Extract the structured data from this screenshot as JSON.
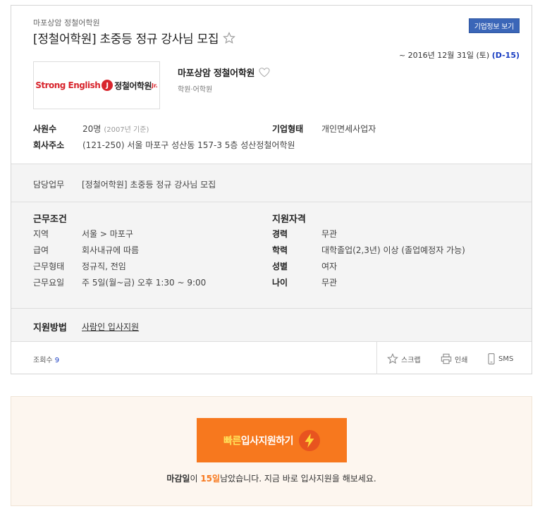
{
  "header": {
    "company_small": "마포상암 정철어학원",
    "title": "[정철어학원] 초중등 정규 강사님 모집",
    "company_info_button": "기업정보 보기",
    "deadline_text": "~ 2016년 12월 31일 (토)",
    "dday": "(D-15)"
  },
  "company": {
    "logo": {
      "brand_en": "Strong English",
      "brand_mark": "J",
      "brand_kr": "정철어학원",
      "brand_jr": "Jr."
    },
    "name": "마포상암 정철어학원",
    "category": "학원·어학원",
    "employees_label": "사원수",
    "employees_value": "20명",
    "employees_note": "(2007년 기준)",
    "type_label": "기업형태",
    "type_value": "개인면세사업자",
    "address_label": "회사주소",
    "address_value": "(121-250) 서울 마포구 성산동 157-3 5층 성산정철어학원"
  },
  "duty": {
    "label": "담당업무",
    "value": "[정철어학원] 초중등 정규 강사님 모집"
  },
  "conditions": {
    "title": "근무조건",
    "items": [
      {
        "label": "지역",
        "value": "서울 > 마포구"
      },
      {
        "label": "급여",
        "value": "회사내규에 따름"
      },
      {
        "label": "근무형태",
        "value": "정규직, 전임"
      },
      {
        "label": "근무요일",
        "value": "주 5일(월~금) 오후 1:30 ~ 9:00"
      }
    ]
  },
  "qualifications": {
    "title": "지원자격",
    "items": [
      {
        "label": "경력",
        "value": "무관"
      },
      {
        "label": "학력",
        "value": "대학졸업(2,3년) 이상 (졸업예정자 가능)"
      },
      {
        "label": "성별",
        "value": "여자"
      },
      {
        "label": "나이",
        "value": "무관"
      }
    ]
  },
  "apply_method": {
    "label": "지원방법",
    "link": "사람인 입사지원"
  },
  "footer": {
    "views_label": "조회수",
    "views_count": "9",
    "scrap": "스크랩",
    "print": "인쇄",
    "sms": "SMS"
  },
  "apply_box": {
    "button_highlight": "빠른",
    "button_text": "입사지원하기",
    "msg_bold": "마감일",
    "msg_mid": "이 ",
    "msg_days": "15일",
    "msg_rest": "남았습니다. 지금 바로 입사지원을 해보세요."
  },
  "colors": {
    "accent_blue": "#3b66b8",
    "dday_blue": "#1a3ec2",
    "apply_orange": "#f7781e",
    "logo_red": "#d8262e"
  }
}
